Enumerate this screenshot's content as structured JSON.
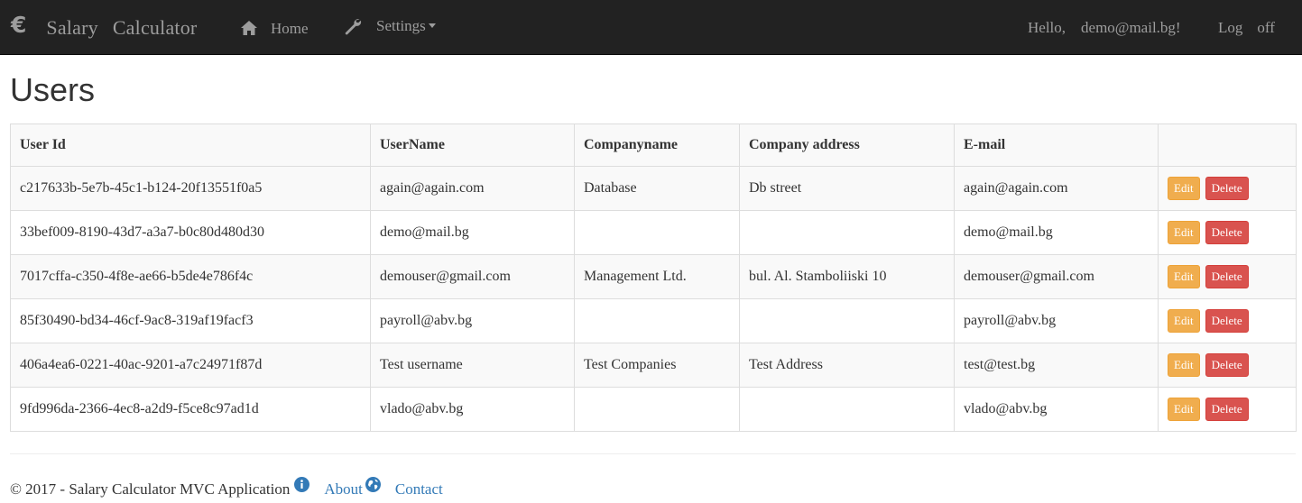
{
  "navbar": {
    "brand_icon": "€",
    "brand_word1": "Salary",
    "brand_word2": "Calculator",
    "home_label": "Home",
    "settings_label": "Settings",
    "hello_word": "Hello,",
    "user_email": "demo@mail.bg!",
    "logoff_word1": "Log",
    "logoff_word2": "off"
  },
  "page": {
    "title": "Users"
  },
  "table": {
    "headers": [
      "User Id",
      "UserName",
      "Companyname",
      "Company address",
      "E-mail",
      ""
    ],
    "rows": [
      {
        "id": "c217633b-5e7b-45c1-b124-20f13551f0a5",
        "username": "again@again.com",
        "company": "Database",
        "address": "Db street",
        "email": "again@again.com"
      },
      {
        "id": "33bef009-8190-43d7-a3a7-b0c80d480d30",
        "username": "demo@mail.bg",
        "company": "",
        "address": "",
        "email": "demo@mail.bg"
      },
      {
        "id": "7017cffa-c350-4f8e-ae66-b5de4e786f4c",
        "username": "demouser@gmail.com",
        "company": "Management Ltd.",
        "address": "bul. Al. Stamboliiski 10",
        "email": "demouser@gmail.com"
      },
      {
        "id": "85f30490-bd34-46cf-9ac8-319af19facf3",
        "username": "payroll@abv.bg",
        "company": "",
        "address": "",
        "email": "payroll@abv.bg"
      },
      {
        "id": "406a4ea6-0221-40ac-9201-a7c24971f87d",
        "username": "Test username",
        "company": "Test Companies",
        "address": "Test Address",
        "email": "test@test.bg"
      },
      {
        "id": "9fd996da-2366-4ec8-a2d9-f5ce8c97ad1d",
        "username": "vlado@abv.bg",
        "company": "",
        "address": "",
        "email": "vlado@abv.bg"
      }
    ],
    "edit_label": "Edit",
    "delete_label": "Delete"
  },
  "footer": {
    "copyright": "© 2017 - Salary Calculator MVC Application",
    "about_label": "About",
    "contact_label": "Contact"
  },
  "colors": {
    "navbar_bg": "#222222",
    "navbar_text": "#9d9d9d",
    "edit_button": "#f0ad4e",
    "delete_button": "#d9534f",
    "link": "#337ab7"
  },
  "icons": [
    "euro-icon",
    "home-icon",
    "wrench-icon",
    "caret-down-icon",
    "info-icon",
    "globe-icon"
  ]
}
